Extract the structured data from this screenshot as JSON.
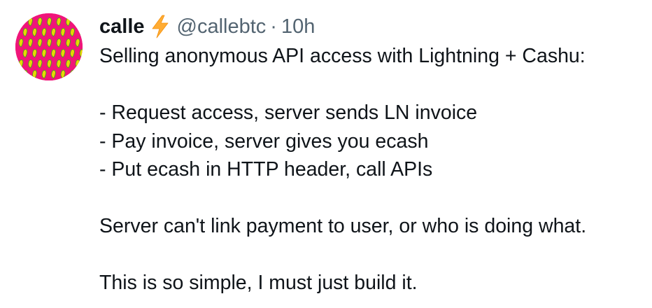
{
  "tweet": {
    "display_name": "calle",
    "verified_icon": "lightning-bolt-icon",
    "handle": "@callebtc",
    "separator": "·",
    "timestamp": "10h",
    "lines": [
      "Selling anonymous API access with Lightning + Cashu:",
      "",
      "- Request access, server sends LN invoice",
      "- Pay invoice, server gives you ecash",
      "- Put ecash in HTTP header, call APIs",
      "",
      "Server can't link payment to user, or who is doing what.",
      "",
      "This is so simple, I must just build it."
    ]
  },
  "colors": {
    "text": "#0f1419",
    "secondary_text": "#536471",
    "avatar_background": "#f0157a",
    "bolt": "#ffac33"
  }
}
